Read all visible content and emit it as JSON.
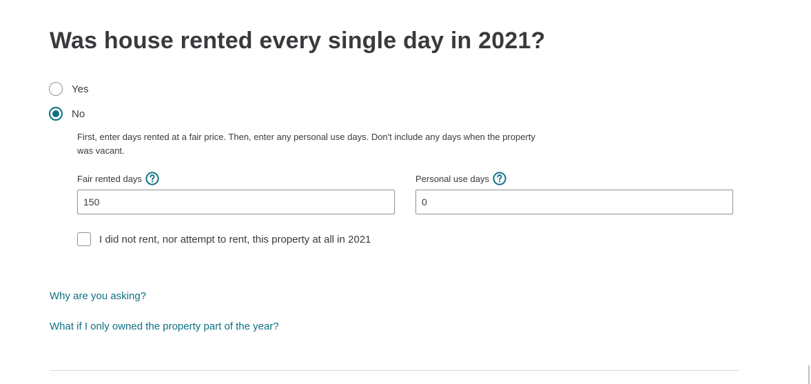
{
  "question": {
    "title": "Was house rented every single day in 2021?"
  },
  "options": {
    "yes_label": "Yes",
    "no_label": "No",
    "selected": "No"
  },
  "details": {
    "hint": "First, enter days rented at a fair price. Then, enter any personal use days. Don't include any days when the property was vacant.",
    "fair_rented": {
      "label": "Fair rented days",
      "value": "150",
      "help_icon": "question-circle-icon"
    },
    "personal_use": {
      "label": "Personal use days",
      "value": "0",
      "help_icon": "question-circle-icon"
    },
    "no_rent_checkbox": {
      "label": "I did not rent, nor attempt to rent, this property at all in 2021",
      "checked": false
    }
  },
  "links": {
    "why": "Why are you asking?",
    "part_year": "What if I only owned the property part of the year?"
  },
  "colors": {
    "accent": "#0d6f84",
    "text": "#393a3d",
    "border": "#8d9096",
    "divider": "#d4d7dc"
  }
}
